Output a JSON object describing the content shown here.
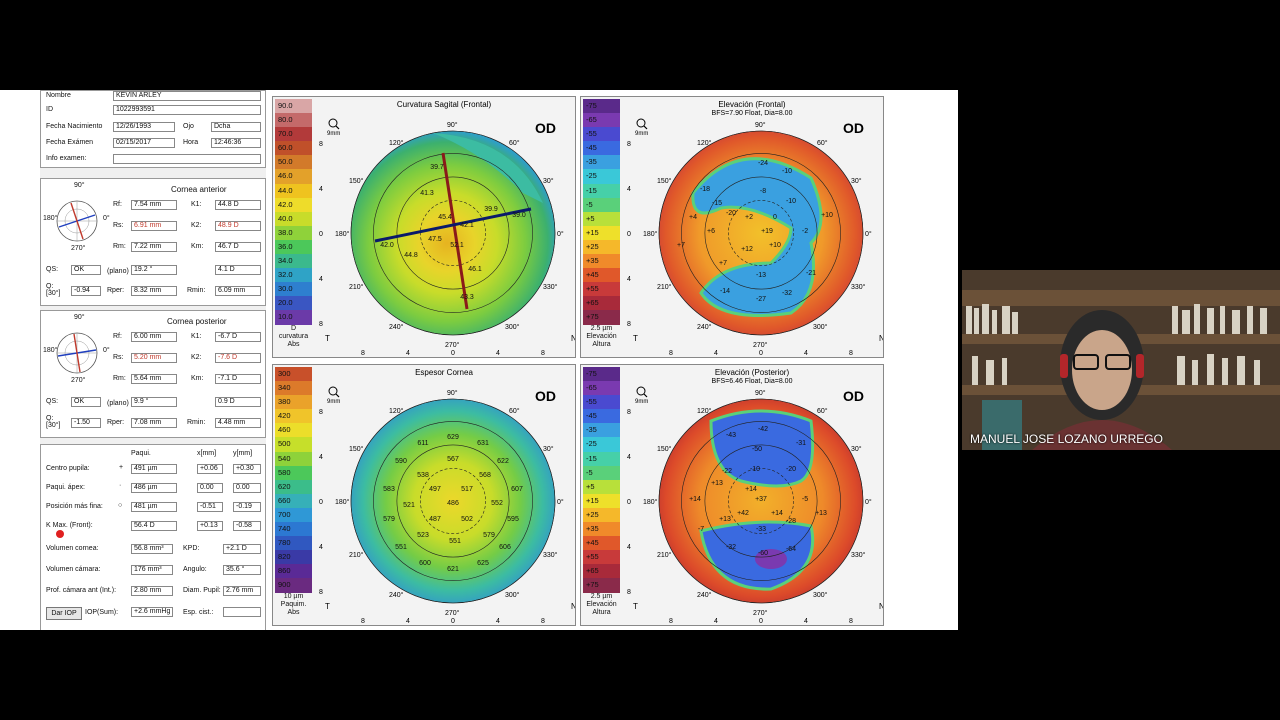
{
  "patient": {
    "nombre_label": "Nombre",
    "nombre": "KEVIN ARLEY",
    "id_label": "ID",
    "id": "1022993591",
    "fnac_label": "Fecha Nacimiento",
    "fnac": "12/26/1993",
    "ojo_label": "Ojo",
    "ojo": "Dcha",
    "fexam_label": "Fecha Exámen",
    "fexam": "02/15/2017",
    "hora_label": "Hora",
    "hora": "12:46:36",
    "info_label": "Info examen:"
  },
  "cornea_anterior": {
    "title": "Cornea anterior",
    "rf_label": "Rf:",
    "rf": "7.54 mm",
    "k1_label": "K1:",
    "k1": "44.8 D",
    "rs_label": "Rs:",
    "rs": "6.91 mm",
    "k2_label": "K2:",
    "k2": "48.9 D",
    "rm_label": "Rm:",
    "rm": "7.22 mm",
    "km_label": "Km:",
    "km": "46.7 D",
    "qs_label": "QS:",
    "qs": "OK",
    "plano": "(plano)",
    "axis": "19.2 °",
    "astig": "4.1 D",
    "q_label": "Q:\n[30°]",
    "q": "-0.94",
    "rper_label": "Rper:",
    "rper": "8.32 mm",
    "rmin_label": "Rmin:",
    "rmin": "6.09 mm",
    "wheel": {
      "top": "90°",
      "bottom": "270°",
      "left": "180°",
      "right": "0°"
    }
  },
  "cornea_posterior": {
    "title": "Cornea posterior",
    "rf_label": "Rf:",
    "rf": "6.00 mm",
    "k1_label": "K1:",
    "k1": "-6.7 D",
    "rs_label": "Rs:",
    "rs": "5.20 mm",
    "k2_label": "K2:",
    "k2": "-7.6 D",
    "rm_label": "Rm:",
    "rm": "5.64 mm",
    "km_label": "Km:",
    "km": "-7.1 D",
    "qs_label": "QS:",
    "qs": "OK",
    "plano": "(plano)",
    "axis": "9.9 °",
    "astig": "0.9 D",
    "q_label": "Q:\n[30°]",
    "q": "-1.50",
    "rper_label": "Rper:",
    "rper": "7.08 mm",
    "rmin_label": "Rmin:",
    "rmin": "4.48 mm",
    "wheel": {
      "top": "90°",
      "bottom": "270°",
      "left": "180°",
      "right": "0°"
    }
  },
  "paqui": {
    "h_paqui": "Paqui.",
    "h_x": "x[mm]",
    "h_y": "y[mm]",
    "rows": [
      {
        "label": "Centro pupila:",
        "mark": "+",
        "v": "491 µm",
        "x": "+0.06",
        "y": "+0.30"
      },
      {
        "label": "Paqui. ápex:",
        "mark": "·",
        "v": "486 µm",
        "x": "0.00",
        "y": "0.00"
      },
      {
        "label": "Posición más fina:",
        "mark": "○",
        "v": "481 µm",
        "x": "-0.51",
        "y": "-0.19"
      },
      {
        "label": "K Max. (Front):",
        "mark": "",
        "v": "56.4 D",
        "x": "+0.13",
        "y": "-0.58"
      }
    ]
  },
  "volumes": {
    "vol_cornea_label": "Volumen cornea:",
    "vol_cornea": "56.8 mm³",
    "kpd_label": "KPD:",
    "kpd": "+2.1 D",
    "vol_camara_label": "Volumen cámara:",
    "vol_camara": "176 mm³",
    "angulo_label": "Angulo:",
    "angulo": "35.6 °",
    "prof_label": "Prof. cámara ant (Int.):",
    "prof": "2.80 mm",
    "diam_label": "Diam. Pupil:",
    "diam": "2.76 mm",
    "iop_button": "Dar IOP",
    "iop_label": "IOP(Sum):",
    "iop": "+2.6 mmHg",
    "esp_label": "Esp. cist.:",
    "esp": ""
  },
  "maps": [
    {
      "title": "Curvatura Sagital (Frontal)",
      "subtitle": "",
      "eye": "OD",
      "zoom": "9mm",
      "scale_values": [
        "90.0",
        "80.0",
        "70.0",
        "60.0",
        "50.0",
        "46.0",
        "44.0",
        "42.0",
        "40.0",
        "38.0",
        "36.0",
        "34.0",
        "32.0",
        "30.0",
        "20.0",
        "10.0"
      ],
      "scale_caption": [
        "D",
        "curvatura",
        "Abs"
      ],
      "labels": [
        {
          "t": "39.7"
        },
        {
          "t": "41.3"
        },
        {
          "t": "39.9"
        },
        {
          "t": "39.0"
        },
        {
          "t": "45.4"
        },
        {
          "t": "42.1"
        },
        {
          "t": "47.5"
        },
        {
          "t": "52.1"
        },
        {
          "t": "42.0"
        },
        {
          "t": "44.8"
        },
        {
          "t": "46.1"
        },
        {
          "t": "43.3"
        }
      ]
    },
    {
      "title": "Elevación (Frontal)",
      "subtitle": "BFS=7.90 Float, Dia=8.00",
      "eye": "OD",
      "zoom": "9mm",
      "scale_values": [
        "-75",
        "-65",
        "-55",
        "-45",
        "-35",
        "-25",
        "-15",
        "-5",
        "+5",
        "+15",
        "+25",
        "+35",
        "+45",
        "+55",
        "+65",
        "+75"
      ],
      "scale_caption": [
        "2.5 µm",
        "Elevación",
        "Altura"
      ],
      "labels": [
        {
          "t": "-24"
        },
        {
          "t": "-18"
        },
        {
          "t": "-10"
        },
        {
          "t": "-15"
        },
        {
          "t": "-8"
        },
        {
          "t": "-10"
        },
        {
          "t": "-20"
        },
        {
          "t": "+10"
        },
        {
          "t": "+6"
        },
        {
          "t": "+2"
        },
        {
          "t": "0"
        },
        {
          "t": "+19"
        },
        {
          "t": "+7"
        },
        {
          "t": "+12"
        },
        {
          "t": "+10"
        },
        {
          "t": "-2"
        },
        {
          "t": "+7"
        },
        {
          "t": "-13"
        },
        {
          "t": "-21"
        },
        {
          "t": "-14"
        },
        {
          "t": "-32"
        },
        {
          "t": "-27"
        },
        {
          "t": "+4"
        }
      ]
    },
    {
      "title": "Espesor Cornea",
      "subtitle": "",
      "eye": "OD",
      "zoom": "9mm",
      "scale_values": [
        "300",
        "340",
        "380",
        "420",
        "460",
        "500",
        "540",
        "580",
        "620",
        "660",
        "700",
        "740",
        "780",
        "820",
        "860",
        "900"
      ],
      "scale_caption": [
        "10 µm",
        "Paquim.",
        "Abs"
      ],
      "labels": [
        {
          "t": "629"
        },
        {
          "t": "611"
        },
        {
          "t": "631"
        },
        {
          "t": "590"
        },
        {
          "t": "567"
        },
        {
          "t": "622"
        },
        {
          "t": "538"
        },
        {
          "t": "568"
        },
        {
          "t": "583"
        },
        {
          "t": "497"
        },
        {
          "t": "517"
        },
        {
          "t": "607"
        },
        {
          "t": "521"
        },
        {
          "t": "486"
        },
        {
          "t": "552"
        },
        {
          "t": "579"
        },
        {
          "t": "487"
        },
        {
          "t": "502"
        },
        {
          "t": "595"
        },
        {
          "t": "523"
        },
        {
          "t": "551"
        },
        {
          "t": "579"
        },
        {
          "t": "551"
        },
        {
          "t": "606"
        },
        {
          "t": "600"
        },
        {
          "t": "621"
        },
        {
          "t": "625"
        }
      ]
    },
    {
      "title": "Elevación (Posterior)",
      "subtitle": "BFS=6.46 Float, Dia=8.00",
      "eye": "OD",
      "zoom": "9mm",
      "scale_values": [
        "-75",
        "-65",
        "-55",
        "-45",
        "-35",
        "-25",
        "-15",
        "-5",
        "+5",
        "+15",
        "+25",
        "+35",
        "+45",
        "+55",
        "+65",
        "+75"
      ],
      "scale_caption": [
        "2.5 µm",
        "Elevación",
        "Altura"
      ],
      "labels": [
        {
          "t": "-43"
        },
        {
          "t": "-42"
        },
        {
          "t": "-50"
        },
        {
          "t": "-31"
        },
        {
          "t": "-22"
        },
        {
          "t": "-10"
        },
        {
          "t": "-20"
        },
        {
          "t": "+13"
        },
        {
          "t": "+14"
        },
        {
          "t": "+37"
        },
        {
          "t": "-5"
        },
        {
          "t": "+14"
        },
        {
          "t": "+42"
        },
        {
          "t": "+14"
        },
        {
          "t": "+13"
        },
        {
          "t": "+13"
        },
        {
          "t": "-28"
        },
        {
          "t": "-33"
        },
        {
          "t": "-32"
        },
        {
          "t": "-60"
        },
        {
          "t": "-64"
        },
        {
          "t": "-7"
        }
      ]
    }
  ],
  "axes": {
    "deg90": "90°",
    "deg270": "270°",
    "deg60": "60°",
    "deg120": "120°",
    "deg150": "150°",
    "deg30": "30°",
    "deg0": "0°",
    "deg180": "180°",
    "deg210": "210°",
    "deg240": "240°",
    "deg300": "300°",
    "deg330": "330°",
    "T": "T",
    "N": "N",
    "xticks": [
      "8",
      "4",
      "0",
      "4",
      "8"
    ],
    "yticks": [
      "8",
      "4",
      "0",
      "4",
      "8"
    ]
  },
  "participant": {
    "name": "MANUEL JOSE LOZANO URREGO"
  },
  "colors": {
    "bg": "#000000",
    "panel": "#f0f0f0",
    "accent_red": "#c0392b"
  }
}
